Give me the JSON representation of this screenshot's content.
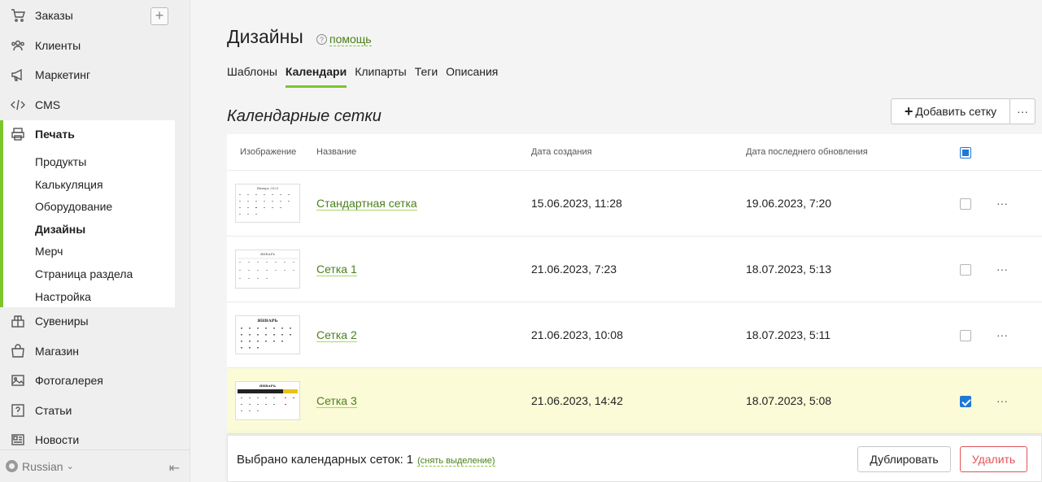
{
  "sidebar": {
    "items_top": [
      {
        "label": "Заказы",
        "icon": "cart-icon"
      },
      {
        "label": "Клиенты",
        "icon": "users-icon"
      },
      {
        "label": "Маркетинг",
        "icon": "megaphone-icon"
      },
      {
        "label": "CMS",
        "icon": "code-icon"
      }
    ],
    "print": {
      "label": "Печать",
      "icon": "printer-icon",
      "sub_items": [
        "Продукты",
        "Калькуляция",
        "Оборудование",
        "Дизайны",
        "Мерч",
        "Страница раздела",
        "Настройка"
      ]
    },
    "items_bottom": [
      {
        "label": "Сувениры",
        "icon": "souvenir-icon"
      },
      {
        "label": "Магазин",
        "icon": "shop-icon"
      },
      {
        "label": "Фотогалерея",
        "icon": "gallery-icon"
      },
      {
        "label": "Статьи",
        "icon": "article-icon"
      },
      {
        "label": "Новости",
        "icon": "news-icon"
      }
    ],
    "language": "Russian"
  },
  "header": {
    "title": "Дизайны",
    "help": "помощь"
  },
  "tabs": [
    {
      "label": "Шаблоны"
    },
    {
      "label": "Календари",
      "active": true
    },
    {
      "label": "Клипарты"
    },
    {
      "label": "Теги"
    },
    {
      "label": "Описания"
    }
  ],
  "section": {
    "title": "Календарные сетки",
    "add_label": "Добавить сетку",
    "more_label": "···"
  },
  "table": {
    "columns": [
      "Изображение",
      "Название",
      "Дата создания",
      "Дата последнего обновления"
    ],
    "rows": [
      {
        "name": "Стандартная сетка",
        "created": "15.06.2023, 11:28",
        "updated": "19.06.2023, 7:20",
        "checked": false
      },
      {
        "name": "Сетка 1",
        "created": "21.06.2023, 7:23",
        "updated": "18.07.2023, 5:13",
        "checked": false
      },
      {
        "name": "Сетка 2",
        "created": "21.06.2023, 10:08",
        "updated": "18.07.2023, 5:11",
        "checked": false
      },
      {
        "name": "Сетка 3",
        "created": "21.06.2023, 14:42",
        "updated": "18.07.2023, 5:08",
        "checked": true
      }
    ],
    "row_more": "···"
  },
  "footer": {
    "selected_text": "Выбрано календарных сеток:",
    "selected_count": "1",
    "unselect": "(снять выделение)",
    "duplicate": "Дублировать",
    "delete": "Удалить"
  },
  "colors": {
    "accent": "#7bc62d",
    "link": "#4a7f1b",
    "danger": "#e0545a",
    "checkbox": "#1e78d6",
    "selected_row": "#fbfbd7"
  }
}
